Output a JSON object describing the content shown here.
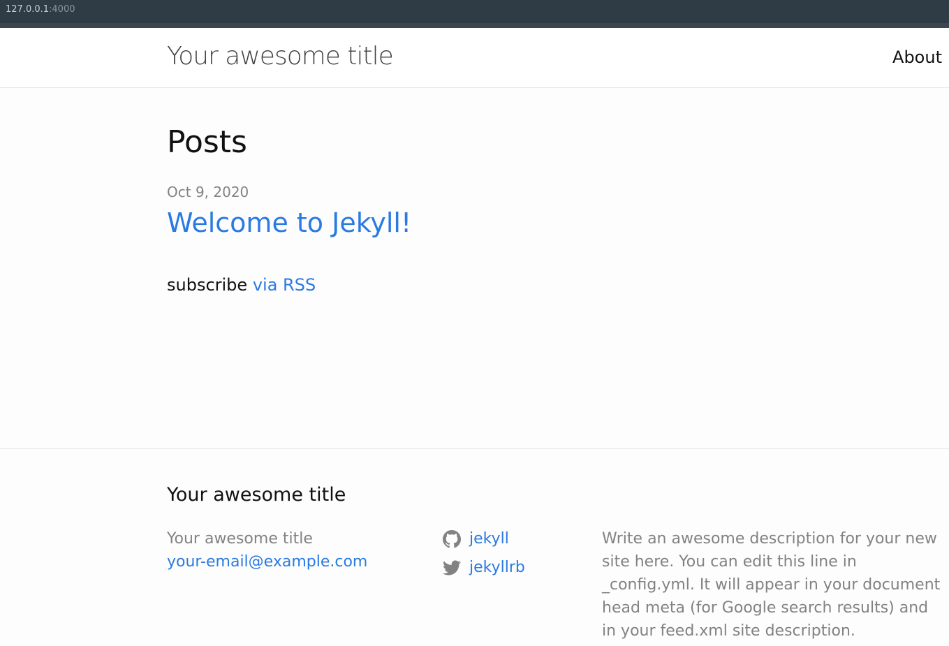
{
  "browser": {
    "host": "127.0.0.1",
    "port": ":4000"
  },
  "header": {
    "site_title": "Your awesome title",
    "nav": [
      {
        "label": "About"
      }
    ]
  },
  "main": {
    "heading": "Posts",
    "posts": [
      {
        "date": "Oct 9, 2020",
        "title": "Welcome to Jekyll!"
      }
    ],
    "subscribe_text": "subscribe",
    "subscribe_link": "via RSS"
  },
  "footer": {
    "heading": "Your awesome title",
    "author_name": "Your awesome title",
    "email": "your-email@example.com",
    "social": [
      {
        "icon": "github-icon",
        "label": "jekyll"
      },
      {
        "icon": "twitter-icon",
        "label": "jekyllrb"
      }
    ],
    "description": "Write an awesome description for your new site here. You can edit this line in _config.yml. It will appear in your document head meta (for Google search results) and in your feed.xml site description."
  },
  "colors": {
    "link": "#2a7ae2",
    "muted": "#828282",
    "text": "#111111",
    "browser_bar": "#2f3b45"
  }
}
